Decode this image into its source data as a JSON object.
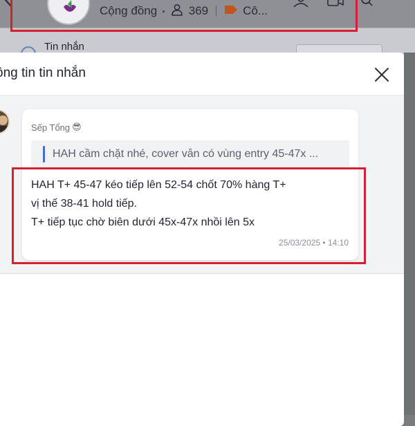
{
  "background": {
    "community_label": "Cộng đồng",
    "member_count": "369",
    "tag_label": "Cô...",
    "sub_label": "Tin nhắn"
  },
  "modal": {
    "title": "ông tin tin nhắn"
  },
  "message": {
    "sender": "Sếp Tổng",
    "sender_emoji": "😎",
    "quote": "HAH cầm chặt nhé, cover vẫn có vùng entry 45-47x ...",
    "lines": [
      "HAH T+ 45-47 kéo tiếp lên 52-54 chốt 70% hàng T+",
      "vị thế 38-41 hold tiếp.",
      "T+ tiếp tục chờ biên dưới 45x-47x nhồi lên 5x"
    ],
    "timestamp": "25/03/2025 • 14:10"
  },
  "colors": {
    "highlight": "#d32130",
    "quote_bar": "#3d6fd8",
    "tag": "#c0561e"
  },
  "icons": [
    "back-icon",
    "person-icon",
    "tag-icon",
    "close-icon"
  ]
}
